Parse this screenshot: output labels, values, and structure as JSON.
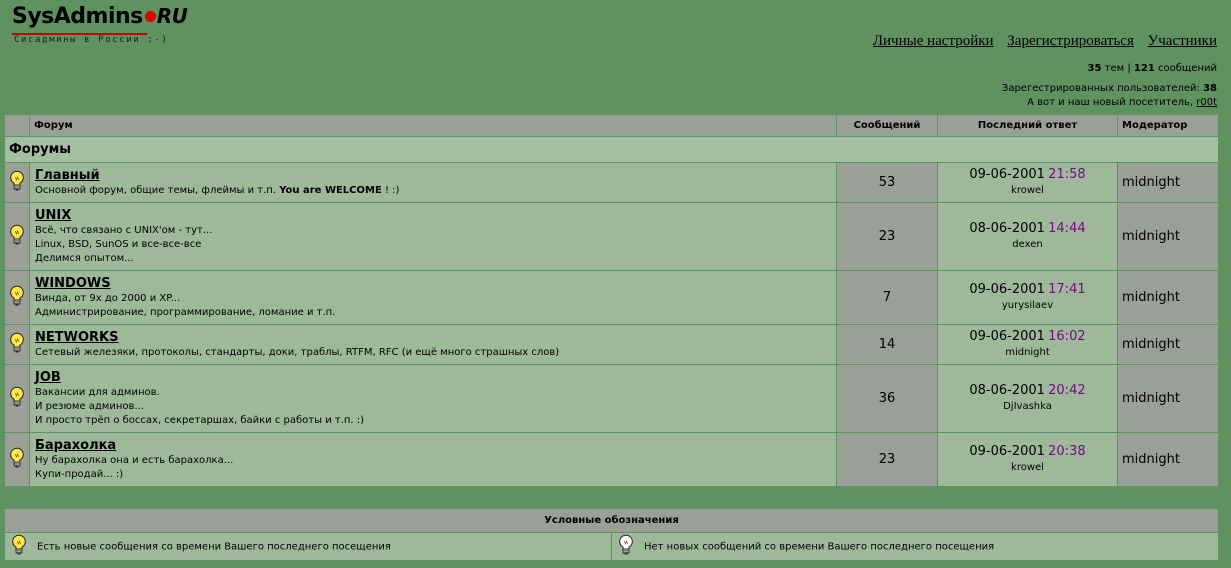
{
  "logo": {
    "main": "SysAdmins",
    "ru": "RU",
    "tagline": "Сисадмины в России ;-)"
  },
  "nav": {
    "profile": "Личные настройки",
    "register": "Зарегистрироваться",
    "members": "Участники"
  },
  "stats": {
    "topics_count": "35",
    "topics_label": "тем",
    "separator": "|",
    "posts_count": "121",
    "posts_label": "сообщений",
    "registered_label": "Зарегестрированных пользователей:",
    "registered_count": "38",
    "newest_label": "А вот и наш новый посетитель,",
    "newest_user": "r00t"
  },
  "table_headers": {
    "forum": "Форум",
    "posts": "Сообщений",
    "last_reply": "Последний ответ",
    "moderator": "Модератор"
  },
  "category": "Форумы",
  "forums": [
    {
      "name": "Главный",
      "desc": [
        "Основной форум, общие темы, флеймы и т.п.",
        "You are WELCOME",
        "! :)"
      ],
      "posts": "53",
      "last_date": "09-06-2001",
      "last_time": "21:58",
      "last_user": "krowel",
      "moderator": "midnight",
      "icon": "bulb-new-icon"
    },
    {
      "name": "UNIX",
      "desc_lines": [
        "Всё, что связано с UNIX'ом - тут...",
        "Linux, BSD, SunOS и все-все-все",
        "Делимся опытом..."
      ],
      "posts": "23",
      "last_date": "08-06-2001",
      "last_time": "14:44",
      "last_user": "dexen",
      "moderator": "midnight",
      "icon": "bulb-new-icon"
    },
    {
      "name": "WINDOWS",
      "desc_lines": [
        "Винда, от 9x до 2000 и XP...",
        "Администрирование, программирование, ломание и т.п."
      ],
      "posts": "7",
      "last_date": "09-06-2001",
      "last_time": "17:41",
      "last_user": "yurysilaev",
      "moderator": "midnight",
      "icon": "bulb-new-icon"
    },
    {
      "name": "NETWORKS",
      "desc_lines": [
        "Сетевый железяки, протоколы, стандарты, доки, траблы, RTFM, RFC (и ещё много страшных слов)"
      ],
      "posts": "14",
      "last_date": "09-06-2001",
      "last_time": "16:02",
      "last_user": "midnight",
      "moderator": "midnight",
      "icon": "bulb-new-icon"
    },
    {
      "name": "JOB",
      "desc_lines": [
        "Вакансии для админов.",
        "И резюме админов...",
        "И просто трёп о боссах, секретаршах, байки с работы и т.п. :)"
      ],
      "posts": "36",
      "last_date": "08-06-2001",
      "last_time": "20:42",
      "last_user": "DjIvashka",
      "moderator": "midnight",
      "icon": "bulb-new-icon"
    },
    {
      "name": "Барахолка",
      "desc_lines": [
        "Ну барахолка она и есть барахолка...",
        "Купи-продай... :)"
      ],
      "posts": "23",
      "last_date": "09-06-2001",
      "last_time": "20:38",
      "last_user": "krowel",
      "moderator": "midnight",
      "icon": "bulb-new-icon"
    }
  ],
  "legend": {
    "title": "Условные обозначения",
    "new_posts": "Есть новые сообщения со времени Вашего последнего посещения",
    "no_new_posts": "Нет новых сообщений со времени Вашего последнего посещения"
  },
  "colors": {
    "page_bg": "#5f9260",
    "row_bg": "#9db99a",
    "header_bg": "#9a9f98",
    "time_color": "#7a0a86",
    "logo_dot": "#e00000"
  }
}
